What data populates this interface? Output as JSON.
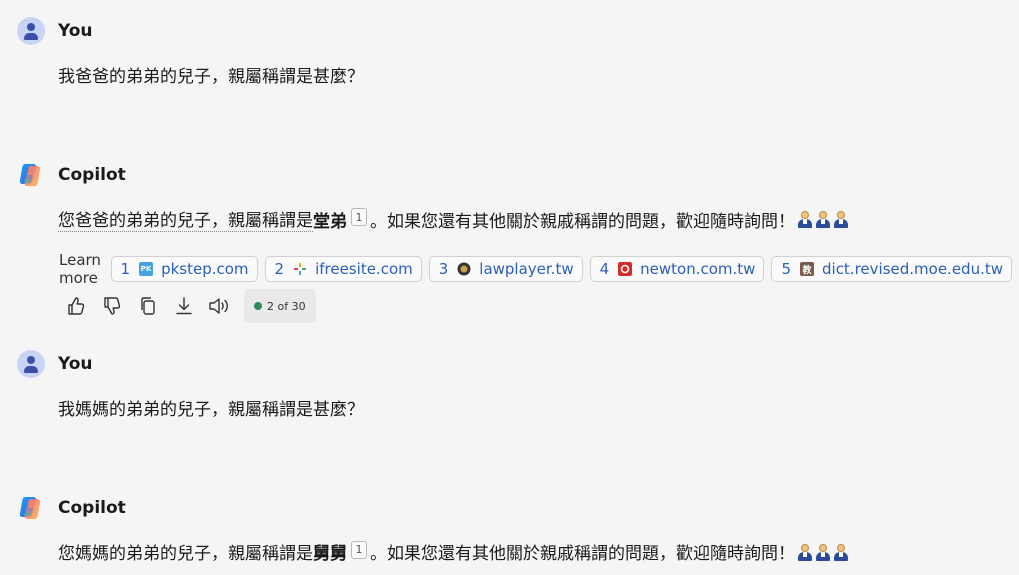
{
  "conversation": [
    {
      "author": "You",
      "text": "我爸爸的弟弟的兒子，親屬稱謂是甚麼？"
    },
    {
      "author": "Copilot",
      "text_before_dotted": "您爸爸的弟弟的兒子，親屬稱謂是",
      "highlight": "堂弟",
      "citation": "1",
      "text_after": "。如果您還有其他關於親戚稱謂的問題，歡迎隨時詢問！",
      "emoji": "family-people-emoji",
      "learn_more_label": "Learn more",
      "sources": [
        {
          "num": "1",
          "name": "pkstep.com",
          "favicon_color": "#4aa3df",
          "favicon_text": "PK"
        },
        {
          "num": "2",
          "name": "ifreesite.com",
          "favicon_color": "#f0a020",
          "favicon_text": ""
        },
        {
          "num": "3",
          "name": "lawplayer.tw",
          "favicon_color": "#333333",
          "favicon_text": ""
        },
        {
          "num": "4",
          "name": "newton.com.tw",
          "favicon_color": "#d62b2b",
          "favicon_text": ""
        },
        {
          "num": "5",
          "name": "dict.revised.moe.edu.tw",
          "favicon_color": "#7a5a4a",
          "favicon_text": "教"
        }
      ],
      "actions": [
        "thumbs-up-icon",
        "thumbs-down-icon",
        "copy-icon",
        "download-icon",
        "read-aloud-icon"
      ],
      "page_indicator": "2 of 30"
    },
    {
      "author": "You",
      "text": "我媽媽的弟弟的兒子，親屬稱謂是甚麼？"
    },
    {
      "author": "Copilot",
      "text_before": "您媽媽的弟弟的兒子，親屬稱謂是",
      "highlight": "舅舅",
      "citation": "1",
      "text_after": "。如果您還有其他關於親戚稱謂的問題，歡迎隨時詢問！"
    }
  ],
  "colors": {
    "background": "#f5f5f5",
    "link": "#2b5fb8",
    "status_dot": "#2e8b57"
  }
}
